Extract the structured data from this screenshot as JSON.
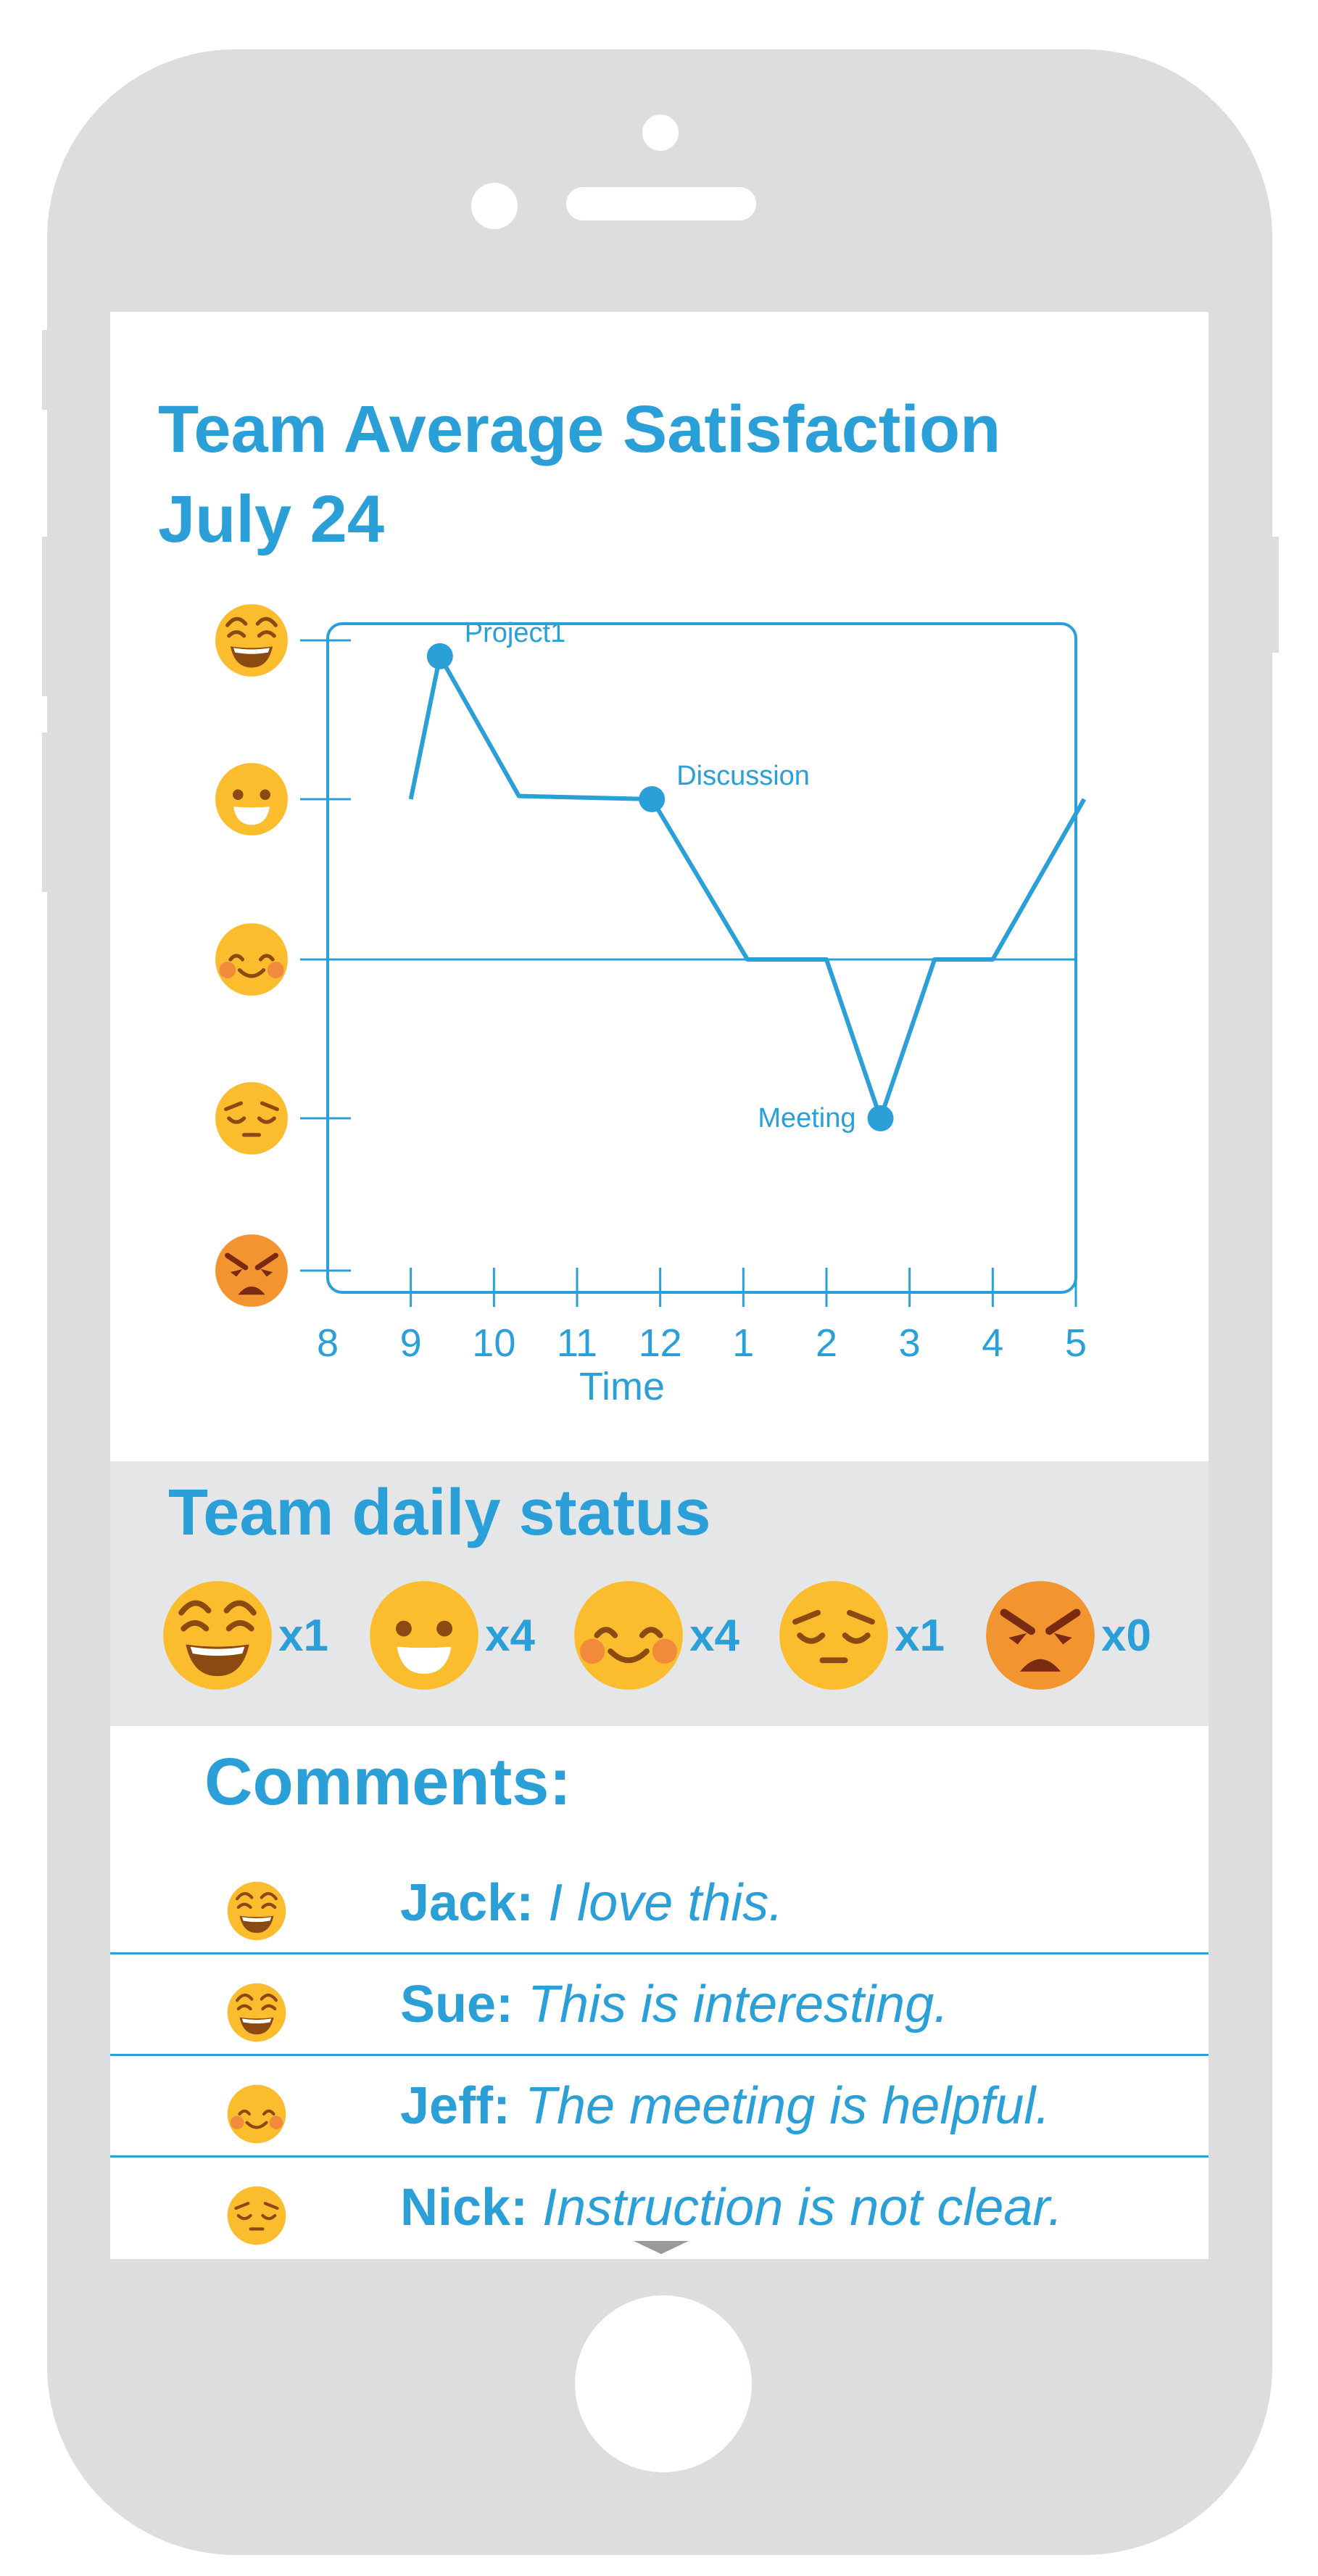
{
  "colors": {
    "accent": "#2a9fd8",
    "phone_body": "#dcdddf",
    "status_band": "#e5e6e8",
    "emoji_yellow": "#fbbd2e",
    "emoji_orange": "#f29430"
  },
  "chart_data": {
    "type": "line",
    "title_line1": "Team Average Satisfaction",
    "title_line2": "July 24",
    "xlabel": "Time",
    "x_ticks": [
      "8",
      "9",
      "10",
      "11",
      "12",
      "1",
      "2",
      "3",
      "4",
      "5"
    ],
    "y_levels": [
      "grinning-face-icon",
      "smiling-face-icon",
      "blushing-face-icon",
      "pensive-face-icon",
      "angry-face-icon"
    ],
    "y_scale": [
      1,
      5
    ],
    "series": [
      {
        "x": [
          9.0,
          9.35,
          10.3,
          11.9,
          13.05,
          14.0,
          14.65,
          15.3,
          16.0,
          17.1
        ],
        "y": [
          4,
          4.9,
          4.02,
          4,
          3,
          3,
          2,
          3,
          3,
          4
        ]
      }
    ],
    "annotations": [
      {
        "text": "Project1",
        "x": 9.35,
        "y": 4.9
      },
      {
        "text": "Discussion",
        "x": 11.9,
        "y": 4
      },
      {
        "text": "Meeting",
        "x": 14.65,
        "y": 2
      }
    ]
  },
  "status": {
    "title": "Team daily status",
    "items": [
      {
        "icon": "grinning-face-icon",
        "count": "x1"
      },
      {
        "icon": "smiling-face-icon",
        "count": "x4"
      },
      {
        "icon": "blushing-face-icon",
        "count": "x4"
      },
      {
        "icon": "pensive-face-icon",
        "count": "x1"
      },
      {
        "icon": "angry-face-icon",
        "count": "x0"
      }
    ]
  },
  "comments": {
    "title": "Comments:",
    "items": [
      {
        "icon": "grinning-face-icon",
        "name": "Jack:",
        "text": "I love this."
      },
      {
        "icon": "grinning-face-icon",
        "name": "Sue:",
        "text": "This is interesting."
      },
      {
        "icon": "blushing-face-icon",
        "name": "Jeff:",
        "text": "The meeting is helpful."
      },
      {
        "icon": "pensive-face-icon",
        "name": "Nick:",
        "text": "Instruction is not clear."
      }
    ]
  }
}
